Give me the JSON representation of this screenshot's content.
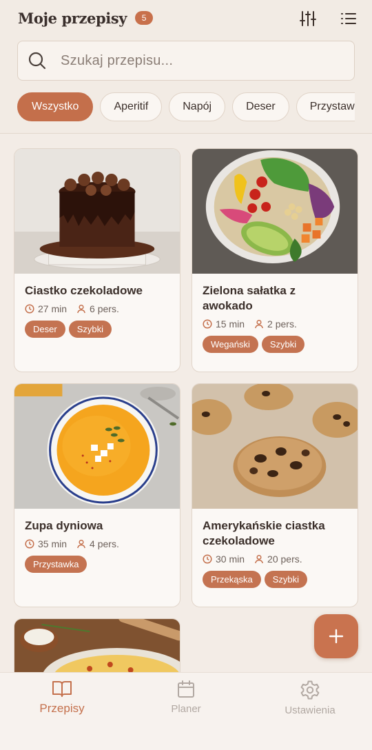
{
  "header": {
    "title": "Moje przepisy",
    "count": "5",
    "filter_icon": "sliders-icon",
    "list_icon": "list-icon"
  },
  "search": {
    "placeholder": "Szukaj przepisu...",
    "value": ""
  },
  "filters": [
    {
      "label": "Wszystko",
      "active": true
    },
    {
      "label": "Aperitif",
      "active": false
    },
    {
      "label": "Napój",
      "active": false
    },
    {
      "label": "Deser",
      "active": false
    },
    {
      "label": "Przystawka",
      "active": false
    }
  ],
  "recipes": [
    {
      "name": "Ciastko czekoladowe",
      "time": "27 min",
      "servings": "6 pers.",
      "tags": [
        "Deser",
        "Szybki"
      ],
      "image": "chocolate-cake"
    },
    {
      "name": "Zielona sałatka z awokado",
      "time": "15 min",
      "servings": "2 pers.",
      "tags": [
        "Wegański",
        "Szybki"
      ],
      "image": "avocado-salad"
    },
    {
      "name": "Zupa dyniowa",
      "time": "35 min",
      "servings": "4 pers.",
      "tags": [
        "Przystawka"
      ],
      "image": "pumpkin-soup"
    },
    {
      "name": "Amerykańskie ciastka czekoladowe",
      "time": "30 min",
      "servings": "20 pers.",
      "tags": [
        "Przekąska",
        "Szybki"
      ],
      "image": "chocolate-chip-cookies"
    },
    {
      "name": "",
      "time": "",
      "servings": "",
      "tags": [],
      "image": "pasta-dish"
    }
  ],
  "tabs": [
    {
      "label": "Przepisy",
      "icon": "book-icon",
      "active": true
    },
    {
      "label": "Planer",
      "icon": "calendar-icon",
      "active": false
    },
    {
      "label": "Ustawienia",
      "icon": "settings-gear-icon",
      "active": false
    }
  ],
  "colors": {
    "accent": "#c8704b",
    "background": "#f3ece6",
    "card": "#fbf8f5"
  }
}
